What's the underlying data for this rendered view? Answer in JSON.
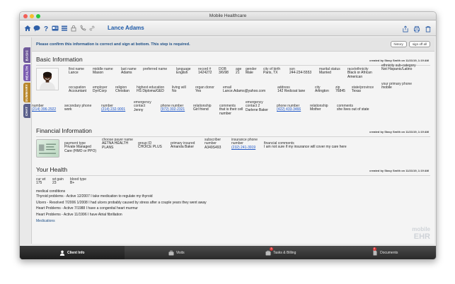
{
  "window": {
    "title": "Mobile Healthcare"
  },
  "toolbar": {
    "patient_name": "Lance Adams"
  },
  "colors": {
    "accent": "#1e5aa8",
    "link": "#1f57c7",
    "tab_basic": "#6f5a9a",
    "tab_health": "#7a5bb0",
    "tab_summary": "#b8872c",
    "tab_chat": "#5a5f8a"
  },
  "sidetabs": [
    "BASIC",
    "HEALTH",
    "SUMMARY",
    "CHAT"
  ],
  "notice": {
    "text": "Please confirm this information is correct and sign at bottom. This step is required.",
    "history_label": "history",
    "signoff_label": "sign off all"
  },
  "basic": {
    "title": "Basic Information",
    "created": "created by Stacy Smith on 11/21/19, 1:19 AM",
    "row1": [
      {
        "label": "first name",
        "value": "Lance"
      },
      {
        "label": "middle name",
        "value": "Mason"
      },
      {
        "label": "last name",
        "value": "Adams"
      },
      {
        "label": "preferred name",
        "value": ""
      },
      {
        "label": "language",
        "value": "English"
      },
      {
        "label": "record #",
        "value": "1424272"
      },
      {
        "label": "DOB",
        "value": "3/6/98"
      },
      {
        "label": "age",
        "value": "21"
      },
      {
        "label": "gender",
        "value": "Male"
      },
      {
        "label": "city of birth",
        "value": "Paris, TX"
      },
      {
        "label": "ssn",
        "value": "244-234-5553"
      },
      {
        "label": "marital status",
        "value": "Married"
      },
      {
        "label": "race/ethnicity",
        "value": "Black or African American"
      },
      {
        "label": "ethnicity sub-category",
        "value": "Not Hispanic/Latino"
      }
    ],
    "row2": [
      {
        "label": "occupation",
        "value": "Accountant"
      },
      {
        "label": "employer",
        "value": "DyriCorp"
      },
      {
        "label": "religion",
        "value": "Christian"
      },
      {
        "label": "highest education",
        "value": "HS Diploma/GED"
      },
      {
        "label": "living will",
        "value": "No"
      },
      {
        "label": "organ donor",
        "value": "Yes"
      },
      {
        "label": "email",
        "value": "Lance.Adams@yahoo.com"
      },
      {
        "label": "address",
        "value": "142 Redcoat lane"
      },
      {
        "label": "city",
        "value": "Arlington"
      },
      {
        "label": "zip",
        "value": "76845"
      },
      {
        "label": "state/province",
        "value": "Texas"
      },
      {
        "label": "your primary phone",
        "value": "mobile"
      }
    ],
    "row3": [
      {
        "label": "number",
        "value": "(214) 396-2922"
      },
      {
        "label": "secondary phone",
        "value": "work"
      },
      {
        "label": "number",
        "value": "(214) 232-9001"
      },
      {
        "label": "emergency contact",
        "value": "Jenny"
      },
      {
        "label": "phone number",
        "value": "(972) 302-2321"
      },
      {
        "label": "relationship",
        "value": "Girl friend"
      },
      {
        "label": "comments",
        "value": "that is their cell number"
      },
      {
        "label": "emergency contact 2",
        "value": "Darlene Baker"
      },
      {
        "label": "phone number",
        "value": "(422) 433-3466"
      },
      {
        "label": "relationship",
        "value": "Mother"
      },
      {
        "label": "comments",
        "value": "she lives out of state"
      }
    ]
  },
  "financial": {
    "title": "Financial Information",
    "created": "created by Stacy Smith on 11/21/19, 1:19 AM",
    "fields": [
      {
        "label": "payment type",
        "value": "Private Managed Care (HMO or PPO)"
      },
      {
        "label": "choose payer name",
        "value": "AETNA HEALTH PLANS"
      },
      {
        "label": "group ID",
        "value": "CHOICE PLUS"
      },
      {
        "label": "primary insured",
        "value": "Amanda Baker"
      },
      {
        "label": "subscriber number",
        "value": "A349S493"
      },
      {
        "label": "insurance phone number",
        "value": "(232) 241-3919"
      },
      {
        "label": "financial comments",
        "value": "I am not sure if my insurance will cover my care here"
      }
    ]
  },
  "health": {
    "title": "Your Health",
    "created": "created by Stacy Smith on 11/21/19, 1:19 AM",
    "vitals": [
      {
        "label": "cur wt",
        "value": "175"
      },
      {
        "label": "wt gain",
        "value": "23"
      },
      {
        "label": "blood type",
        "value": "B+"
      }
    ],
    "conditions_label": "medical conditions",
    "conditions": [
      "Thyroid problems - Active 12/2007 I take medication to regulate my thyroid",
      "Ulcers - Resolved 7/2006 1/2008 I had ulcers probably caused by stress after a couple years they went away",
      "Heart Problems - Active 7/1988 I have a congenital heart murmur",
      "Heart Problems - Active 11/1996 I have Atrial fibrillation"
    ],
    "medications_label": "Medications"
  },
  "watermark": {
    "text1": "mobile",
    "text2": "EHR"
  },
  "bottom_nav": [
    {
      "label": "Client Info"
    },
    {
      "label": "Visits"
    },
    {
      "label": "Tasks & Billing",
      "badge": "3"
    },
    {
      "label": "Documents",
      "badge": "5"
    }
  ]
}
